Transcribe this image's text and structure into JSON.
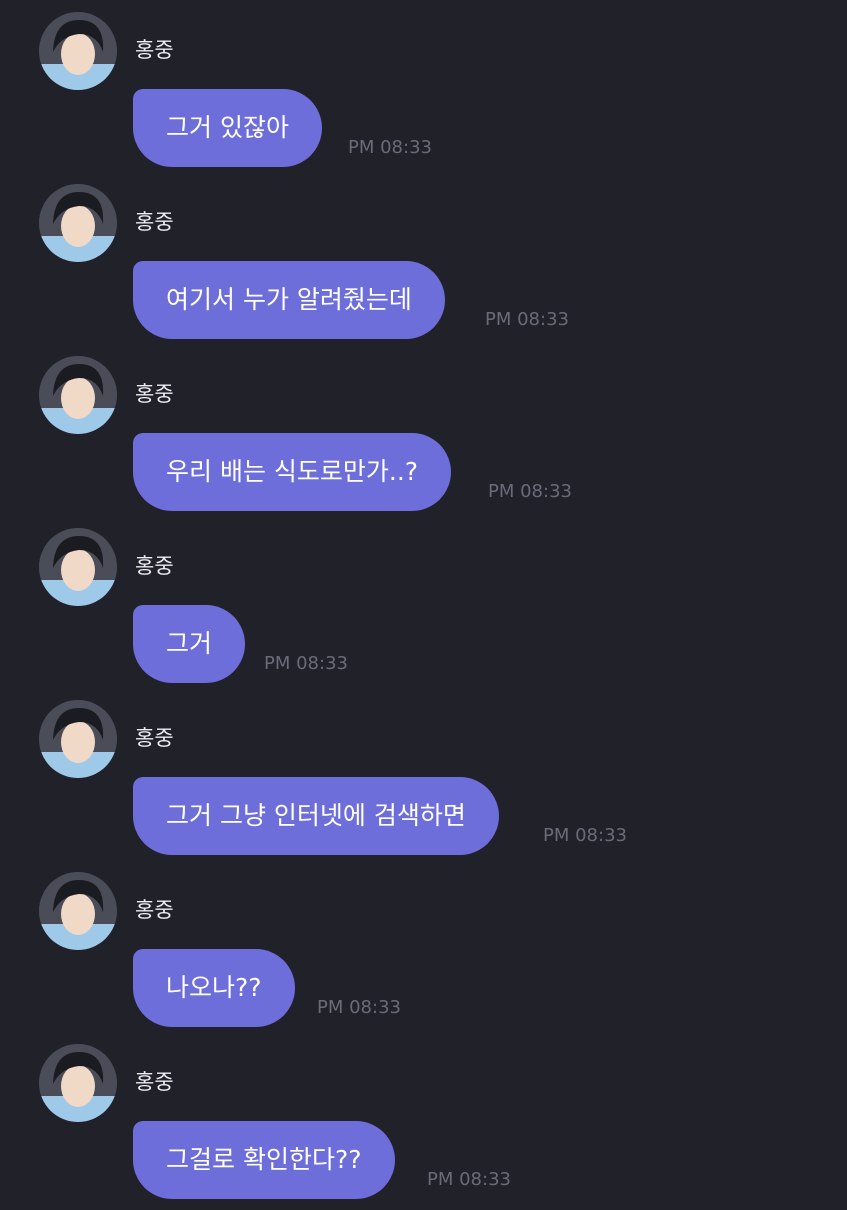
{
  "sender_name": "홍중",
  "avatar_icon": "profile-photo",
  "colors": {
    "background": "#21212a",
    "bubble": "#6e6edb",
    "bubble_text": "#ffffff",
    "name_text": "#ececf0",
    "time_text": "#6a6b78"
  },
  "messages": [
    {
      "text": "그거 있잖아",
      "time": "PM 08:33"
    },
    {
      "text": "여기서 누가 알려줬는데",
      "time": "PM 08:33"
    },
    {
      "text": "우리 배는 식도로만가..?",
      "time": "PM 08:33"
    },
    {
      "text": "그거",
      "time": "PM 08:33"
    },
    {
      "text": "그거 그냥 인터넷에 검색하면",
      "time": "PM 08:33"
    },
    {
      "text": "나오나??",
      "time": "PM 08:33"
    },
    {
      "text": "그걸로 확인한다??",
      "time": "PM 08:33"
    }
  ]
}
